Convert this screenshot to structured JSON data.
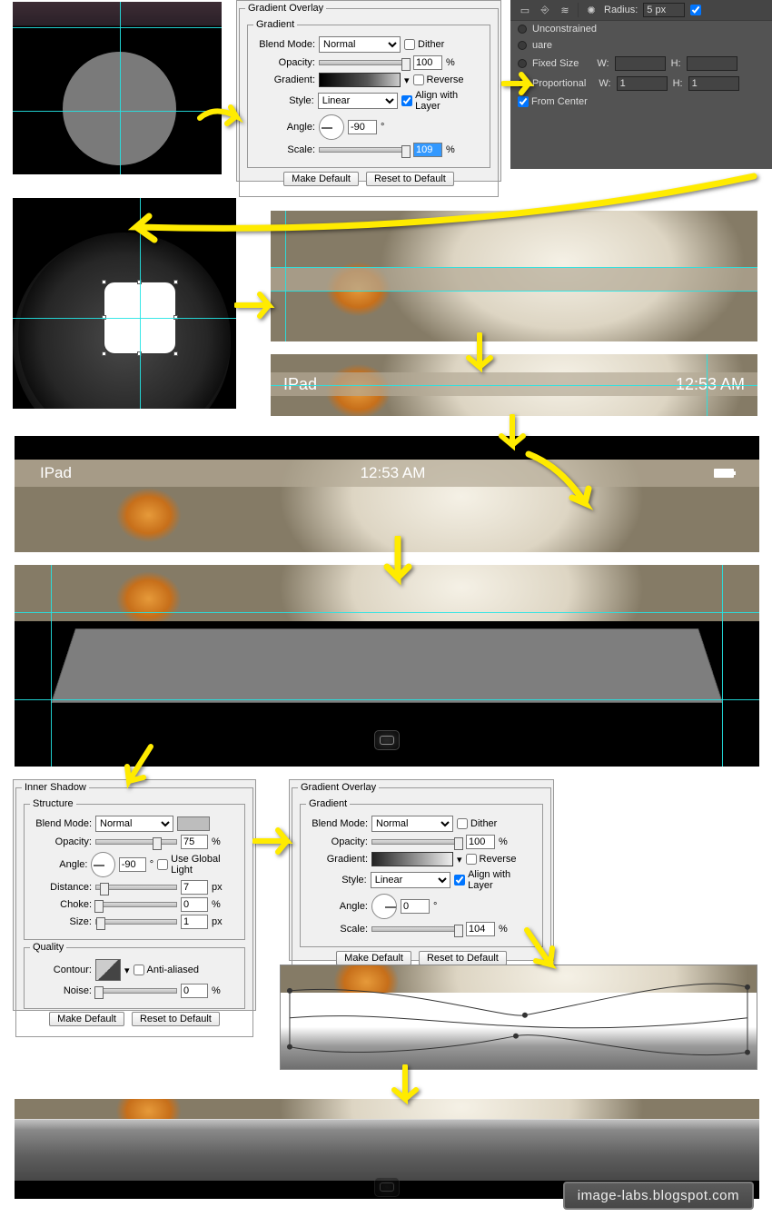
{
  "gradientOverlay1": {
    "title": "Gradient Overlay",
    "group": "Gradient",
    "blendModeLabel": "Blend Mode:",
    "blendMode": "Normal",
    "dither": "Dither",
    "opacityLabel": "Opacity:",
    "opacity": "100",
    "pct": "%",
    "gradientLabel": "Gradient:",
    "reverse": "Reverse",
    "styleLabel": "Style:",
    "style": "Linear",
    "alignWithLayer": "Align with Layer",
    "angleLabel": "Angle:",
    "angle": "-90",
    "deg": "°",
    "scaleLabel": "Scale:",
    "scale": "109",
    "makeDefault": "Make Default",
    "resetToDefault": "Reset to Default"
  },
  "darkPanel": {
    "radiusLabel": "Radius:",
    "radius": "5 px",
    "unconstrained": "Unconstrained",
    "square": "uare",
    "fixedSize": "Fixed Size",
    "wLabel": "W:",
    "hLabel": "H:",
    "proportional": "Proportional",
    "wVal": "1",
    "hVal": "1",
    "fromCenter": "From Center"
  },
  "statusBar": {
    "carrier": "IPad",
    "time": "12:53 AM"
  },
  "innerShadow": {
    "title": "Inner Shadow",
    "structure": "Structure",
    "blendModeLabel": "Blend Mode:",
    "blendMode": "Normal",
    "opacityLabel": "Opacity:",
    "opacity": "75",
    "pct": "%",
    "angleLabel": "Angle:",
    "angle": "-90",
    "deg": "°",
    "useGlobalLight": "Use Global Light",
    "distanceLabel": "Distance:",
    "distance": "7",
    "px": "px",
    "chokeLabel": "Choke:",
    "choke": "0",
    "sizeLabel": "Size:",
    "size": "1",
    "quality": "Quality",
    "contourLabel": "Contour:",
    "antiAliased": "Anti-aliased",
    "noiseLabel": "Noise:",
    "noise": "0",
    "makeDefault": "Make Default",
    "resetToDefault": "Reset to Default"
  },
  "gradientOverlay2": {
    "title": "Gradient Overlay",
    "group": "Gradient",
    "blendModeLabel": "Blend Mode:",
    "blendMode": "Normal",
    "dither": "Dither",
    "opacityLabel": "Opacity:",
    "opacity": "100",
    "pct": "%",
    "gradientLabel": "Gradient:",
    "reverse": "Reverse",
    "styleLabel": "Style:",
    "style": "Linear",
    "alignWithLayer": "Align with Layer",
    "angleLabel": "Angle:",
    "angle": "0",
    "deg": "°",
    "scaleLabel": "Scale:",
    "scale": "104",
    "makeDefault": "Make Default",
    "resetToDefault": "Reset to Default"
  },
  "watermark": "image-labs.blogspot.com"
}
